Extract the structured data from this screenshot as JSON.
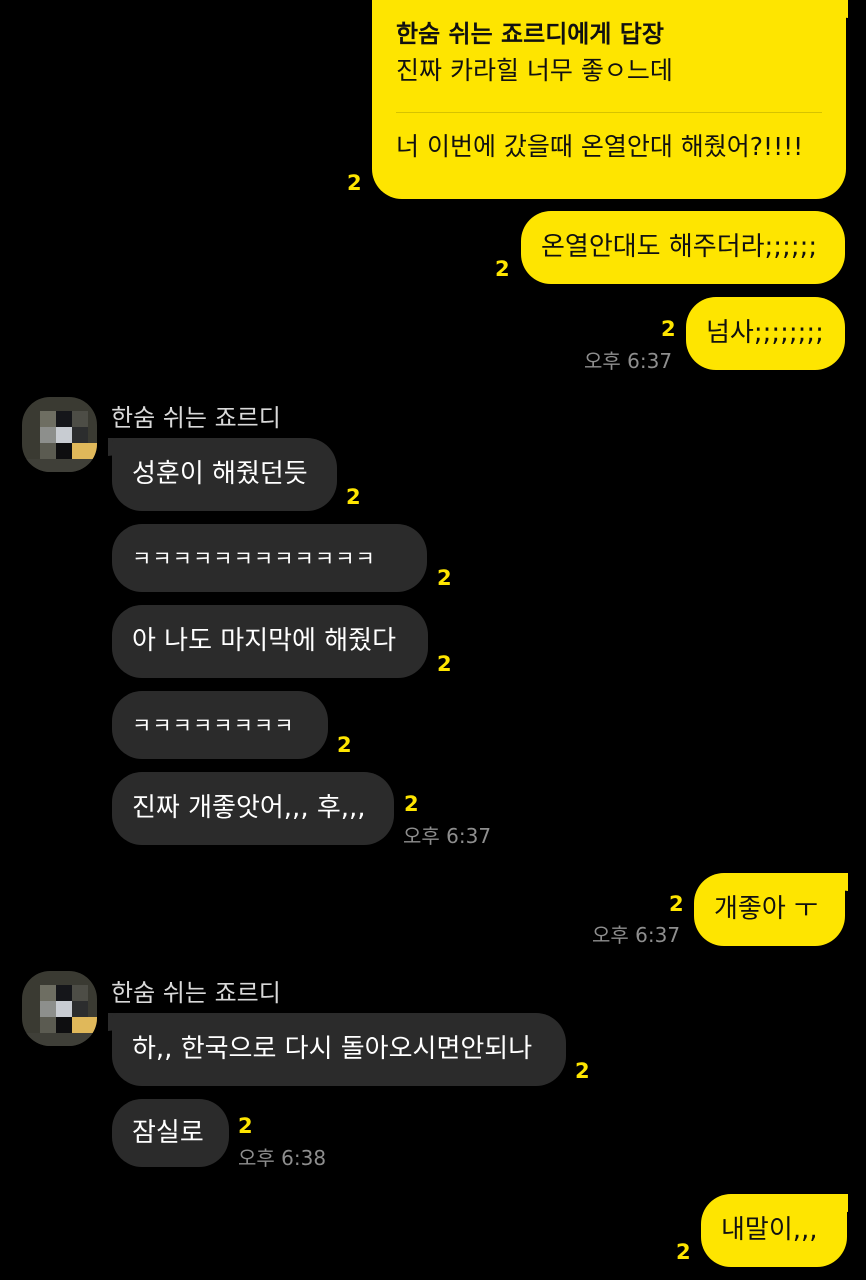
{
  "theme": {
    "me_bubble": "#FEE500",
    "other_bubble": "#2b2b2b",
    "unread_color": "#FEE500",
    "background": "#000000"
  },
  "messages": [
    {
      "reply_title": "한숨 쉬는 죠르디에게 답장",
      "reply_quote": "진짜 카라힐 너무 좋ㅇ느데",
      "text": "너 이번에 갔을때 온열안대 해줬어?!!!!",
      "unread": "2"
    },
    {
      "text": "온열안대도 해주더라;;;;;;",
      "unread": "2"
    },
    {
      "text": "넘사;;;;;;;;",
      "unread": "2",
      "time": "오후 6:37"
    },
    {
      "sender": "한숨 쉬는 죠르디",
      "text": "성훈이 해줬던듯",
      "unread": "2"
    },
    {
      "text": "ㅋㅋㅋㅋㅋㅋㅋㅋㅋㅋㅋㅋ",
      "unread": "2"
    },
    {
      "text": "아 나도 마지막에 해줬다",
      "unread": "2"
    },
    {
      "text": "ㅋㅋㅋㅋㅋㅋㅋㅋ",
      "unread": "2"
    },
    {
      "text": "진짜 개좋앗어,,, 후,,,",
      "unread": "2",
      "time": "오후 6:37"
    },
    {
      "text": "개좋아 ㅜ",
      "unread": "2",
      "time": "오후 6:37"
    },
    {
      "sender": "한숨 쉬는 죠르디",
      "text": "하,, 한국으로 다시 돌아오시면안되나",
      "unread": "2"
    },
    {
      "text": "잠실로",
      "unread": "2",
      "time": "오후 6:38"
    },
    {
      "text": "내말이,,,",
      "unread": "2"
    }
  ]
}
